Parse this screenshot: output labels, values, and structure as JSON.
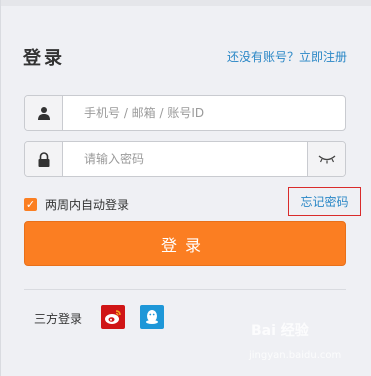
{
  "header": {
    "title": "登录",
    "register_link": "还没有账号？立即注册"
  },
  "form": {
    "account_placeholder": "手机号 / 邮箱 / 账号ID",
    "password_placeholder": "请输入密码",
    "remember_label": "两周内自动登录",
    "remember_checked": true,
    "forgot_link": "忘记密码",
    "login_button": "登录"
  },
  "third_party": {
    "label": "三方登录",
    "providers": [
      "weibo-icon",
      "qq-icon"
    ]
  },
  "watermark": {
    "text": "Bai 经验",
    "sub": "jingyan.baidu.com"
  },
  "colors": {
    "accent": "#fb7e22",
    "link": "#2a87c6",
    "highlight_box": "#d92b2b",
    "weibo": "#d01516",
    "qq": "#1e97d8"
  }
}
